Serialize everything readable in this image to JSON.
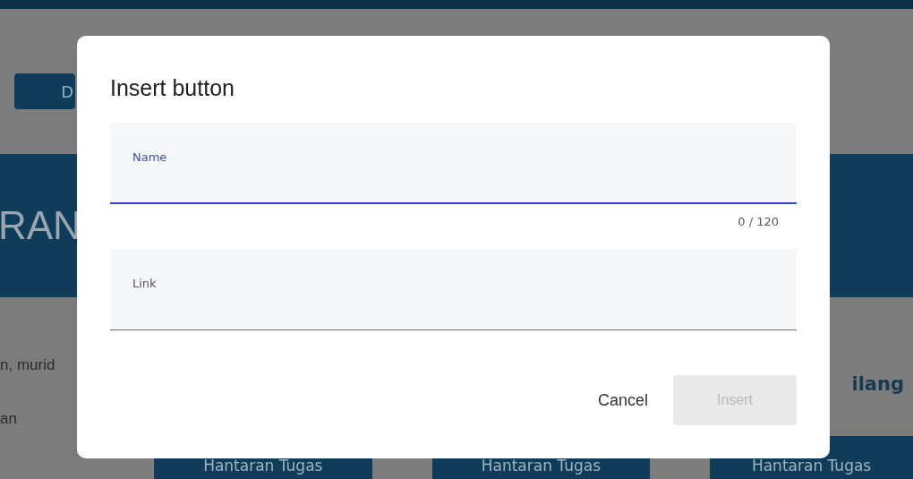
{
  "background_page": {
    "top_button": "D",
    "banner_title": "RAN",
    "left_texts": [
      "n, murid",
      "an"
    ],
    "right_heading": "ilang",
    "bottom_buttons": [
      "Hantaran Tugas",
      "Hantaran Tugas",
      "Hantaran Tugas"
    ]
  },
  "dialog": {
    "title": "Insert button",
    "fields": [
      {
        "label": "Name",
        "focused": true,
        "counter": "0 / 120"
      },
      {
        "label": "Link",
        "focused": false
      }
    ],
    "buttons": [
      {
        "label": "Cancel",
        "kind": "text",
        "disabled": false
      },
      {
        "label": "Insert",
        "kind": "raised",
        "disabled": true
      }
    ]
  }
}
